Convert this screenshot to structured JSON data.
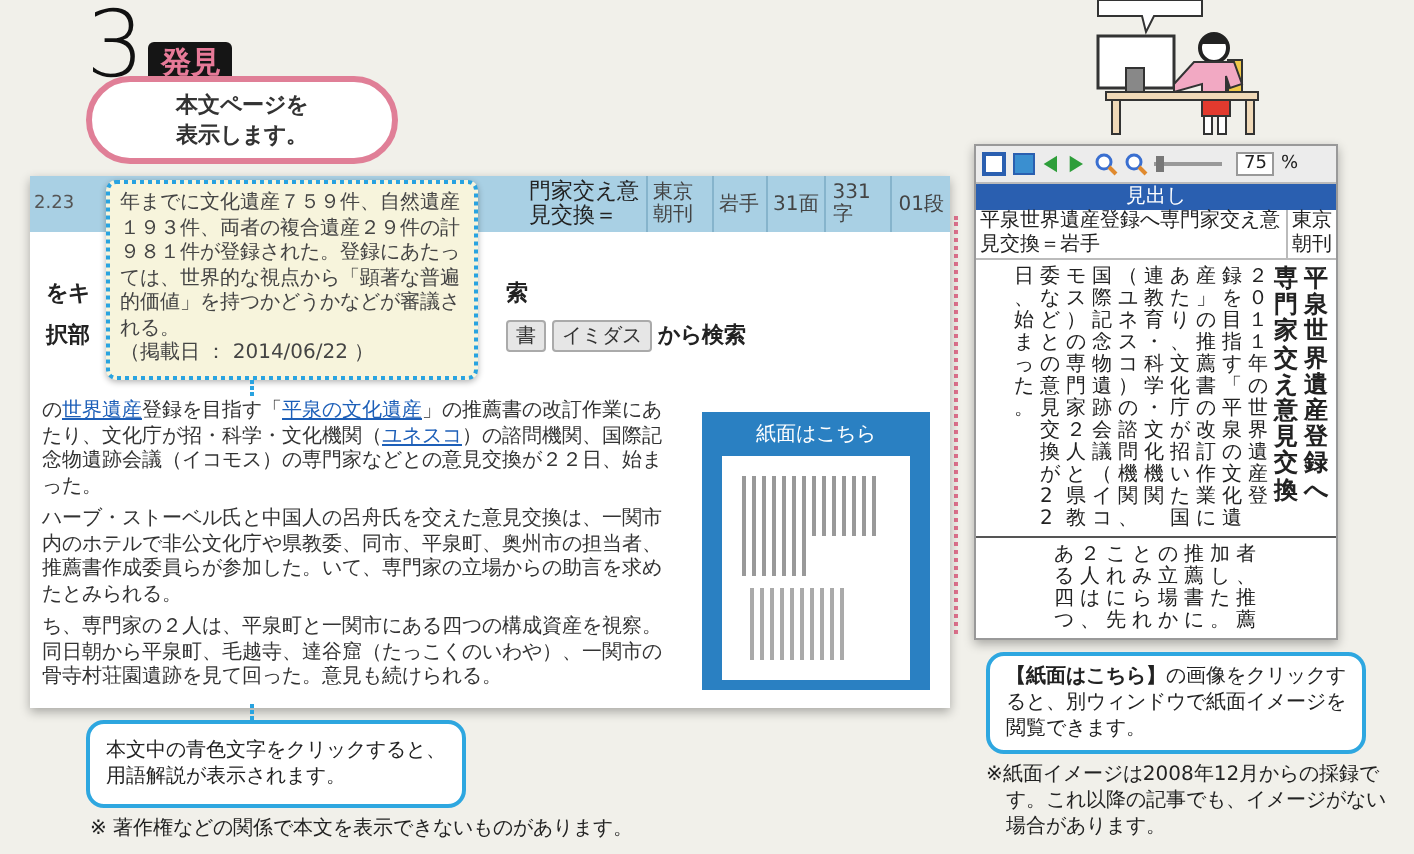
{
  "step": {
    "number": "3",
    "badge": "発見",
    "bubble_lines": [
      "本文ページを",
      "表示します。"
    ]
  },
  "article_screen": {
    "header": {
      "date": "2.23",
      "title": "門家交え意見交換＝",
      "cells": [
        "東京朝刊",
        "岩手",
        "31面",
        "331字",
        "01段"
      ]
    },
    "search_row_1": {
      "lead": "をキ",
      "tail": "索"
    },
    "search_row_2": {
      "lead": "択部",
      "buttons": [
        "書",
        "イミダス"
      ],
      "tail": "から検索"
    },
    "paragraphs": [
      [
        {
          "text": "の",
          "link": false
        },
        {
          "text": "世界遺産",
          "link": true
        },
        {
          "text": "登録を目指す「",
          "link": false
        },
        {
          "text": "平泉の文化遺産",
          "link": true
        },
        {
          "text": "」の推薦書の改訂作業にあたり、文化庁が招・科学・文化機関（",
          "link": false
        },
        {
          "text": "ユネスコ",
          "link": true
        },
        {
          "text": "）の諮問機関、国際記念物遺跡会議（イコモス）の専門家などとの意見交換が２２日、始まった。",
          "link": false
        }
      ],
      [
        {
          "text": "ハーブ・ストーベル氏と中国人の呂舟氏を交えた意見交換は、一関市内のホテルで非公文化庁や県教委、同市、平泉町、奥州市の担当者、推薦書作成委員らが参加した。いて、専門家の立場からの助言を求めたとみられる。",
          "link": false
        }
      ],
      [
        {
          "text": "ち、専門家の２人は、平泉町と一関市にある四つの構成資産を視察。同日朝から平泉町、毛越寺、達谷窟（たっこくのいわや）、一関市の骨寺村荘園遺跡を見て回った。意見も続けられる。",
          "link": false
        }
      ]
    ],
    "paper_panel": {
      "title": "紙面はこちら"
    },
    "tooltip": {
      "text": "年までに文化遺産７５９件、自然遺産１９３件、両者の複合遺産２９件の計９８１件が登録された。登録にあたっては、世界的な視点から「顕著な普遍的価値」を持つかどうかなどが審議される。",
      "date": "（掲載日 ： 2014/06/22 ）"
    }
  },
  "article_callout": {
    "text": "本文中の青色文字をクリックすると、用語解説が表示されます。"
  },
  "article_note": {
    "text": "※ 著作権などの関係で本文を表示できないものがあります。"
  },
  "paper_viewer": {
    "zoom_slider": {
      "level": 0.1
    },
    "zoom_value": "75",
    "zoom_unit": "%",
    "list_header": "見出し",
    "row": {
      "title": "平泉世界遺産登録へ専門家交え意見交換＝岩手",
      "edition": "東京朝刊"
    },
    "headline": [
      "専門家交え意見交換",
      "平泉世界遺産登録へ"
    ],
    "upper_columns": [
      "日、始まった。",
      "委などとの意見交換が22",
      "モス）の専門家２人と県教",
      "国際記念物遺跡会議（イコ",
      "（ユネスコ）の諮問機関、",
      "連教育・科学・文化機関",
      "あたり、文化庁が招いた国",
      "産」の推薦書の改訂作業に",
      "録を目指す「平泉の文化遺",
      "２０１１年の世界遺産登"
    ],
    "lower_columns": [
      "ある四つ",
      "２人は、",
      "これに先",
      "とみられ",
      "の立場か",
      "推薦書に",
      "加した。",
      "者、推薦"
    ]
  },
  "viewer_callout": {
    "text": "**【紙面はこちら】**の画像をクリックすると、別ウィンドウで紙面イメージを閲覧できます。"
  },
  "viewer_note": {
    "text": "※紙面イメージは2008年12月からの採録です。これ以降の記事でも、イメージがない場合があります。"
  }
}
